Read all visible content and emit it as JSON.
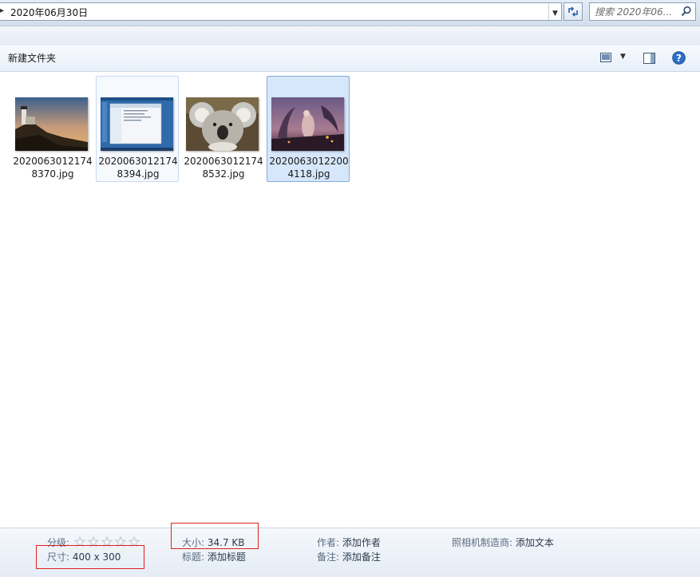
{
  "address": {
    "path": "2020年06月30日"
  },
  "search": {
    "placeholder": "搜索 2020年06..."
  },
  "toolbar": {
    "new_folder_label": "新建文件夹"
  },
  "files": [
    {
      "name": "20200630121748370.jpg",
      "state": "normal"
    },
    {
      "name": "20200630121748394.jpg",
      "state": "hover"
    },
    {
      "name": "20200630121748532.jpg",
      "state": "normal"
    },
    {
      "name": "20200630122004118.jpg",
      "state": "selected"
    }
  ],
  "details": {
    "rating_label": "分级:",
    "rating_stars": 0,
    "dimensions_label": "尺寸:",
    "dimensions_value": "400 x 300",
    "size_label": "大小:",
    "size_value": "34.7 KB",
    "title_label": "标题:",
    "title_value": "添加标题",
    "author_label": "作者:",
    "author_value": "添加作者",
    "comment_label": "备注:",
    "comment_value": "添加备注",
    "camera_label": "照相机制造商:",
    "camera_value": "添加文本"
  },
  "colors": {
    "selection_bg": "#d6e6fb",
    "highlight_box": "#e02020",
    "help_blue": "#2c6ec9"
  }
}
